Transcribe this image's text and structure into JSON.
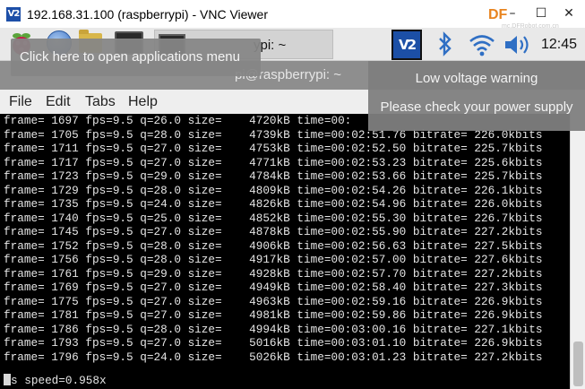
{
  "window": {
    "logo": "V2",
    "title": "192.168.31.100 (raspberrypi) - VNC Viewer",
    "watermark": "DF",
    "watermark_site": "mc.DFRobot.com.cn",
    "minimize": "–",
    "maximize": "☐",
    "close": "✕"
  },
  "panel": {
    "task_label": "ypi: ~",
    "vnc_label": "V2",
    "clock": "12:45"
  },
  "tooltip": {
    "text": "Click here to open applications menu"
  },
  "notification": {
    "title": "Low voltage warning",
    "body": "Please check your power supply"
  },
  "terminal": {
    "title": "pi@raspberrypi: ~",
    "menu": [
      "File",
      "Edit",
      "Tabs",
      "Help"
    ],
    "lines": [
      "frame= 1697 fps=9.5 q=26.0 size=    4720kB time=00:",
      "frame= 1705 fps=9.5 q=28.0 size=    4739kB time=00:02:51.76 bitrate= 226.0kbits",
      "frame= 1711 fps=9.5 q=27.0 size=    4753kB time=00:02:52.50 bitrate= 225.7kbits",
      "frame= 1717 fps=9.5 q=27.0 size=    4771kB time=00:02:53.23 bitrate= 225.6kbits",
      "frame= 1723 fps=9.5 q=29.0 size=    4784kB time=00:02:53.66 bitrate= 225.7kbits",
      "frame= 1729 fps=9.5 q=28.0 size=    4809kB time=00:02:54.26 bitrate= 226.1kbits",
      "frame= 1735 fps=9.5 q=24.0 size=    4826kB time=00:02:54.96 bitrate= 226.0kbits",
      "frame= 1740 fps=9.5 q=25.0 size=    4852kB time=00:02:55.30 bitrate= 226.7kbits",
      "frame= 1745 fps=9.5 q=27.0 size=    4878kB time=00:02:55.90 bitrate= 227.2kbits",
      "frame= 1752 fps=9.5 q=28.0 size=    4906kB time=00:02:56.63 bitrate= 227.5kbits",
      "frame= 1756 fps=9.5 q=28.0 size=    4917kB time=00:02:57.00 bitrate= 227.6kbits",
      "frame= 1761 fps=9.5 q=29.0 size=    4928kB time=00:02:57.70 bitrate= 227.2kbits",
      "frame= 1769 fps=9.5 q=27.0 size=    4949kB time=00:02:58.40 bitrate= 227.3kbits",
      "frame= 1775 fps=9.5 q=27.0 size=    4963kB time=00:02:59.16 bitrate= 226.9kbits",
      "frame= 1781 fps=9.5 q=27.0 size=    4981kB time=00:02:59.86 bitrate= 226.9kbits",
      "frame= 1786 fps=9.5 q=28.0 size=    4994kB time=00:03:00.16 bitrate= 227.1kbits",
      "frame= 1793 fps=9.5 q=27.0 size=    5016kB time=00:03:01.10 bitrate= 226.9kbits",
      "frame= 1796 fps=9.5 q=24.0 size=    5026kB time=00:03:01.23 bitrate= 227.2kbits",
      "s speed=0.958x"
    ]
  }
}
